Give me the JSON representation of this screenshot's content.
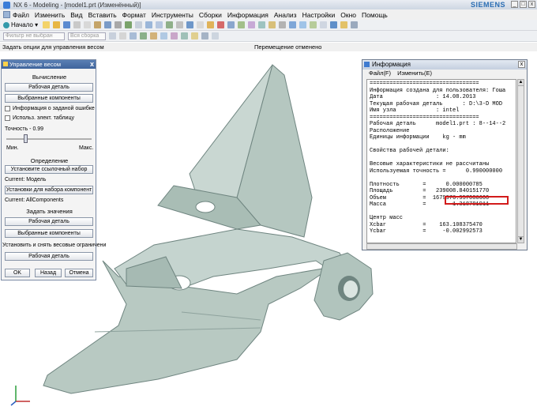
{
  "titlebar": {
    "title": "NX 6 - Modeling - [model1.prt (Изменённый)]",
    "brand": "SIEMENS",
    "min": "_",
    "max": "□",
    "close": "x"
  },
  "menu": {
    "items": [
      "Файл",
      "Изменить",
      "Вид",
      "Вставить",
      "Формат",
      "Инструменты",
      "Сборки",
      "Информация",
      "Анализ",
      "Настройки",
      "Окно",
      "Помощь"
    ]
  },
  "toolbar": {
    "start_label": "Начало ▾",
    "filter_placeholder": "Фильтр не выбран",
    "assembly_placeholder": "Вся сборка"
  },
  "status": {
    "left": "Задать опции для управления весом",
    "middle": "Перемещение отменено"
  },
  "weights_panel": {
    "title": "Управление весом",
    "close": "x",
    "calc_header": "Вычисление",
    "work_part_btn": "Рабочая деталь",
    "selected_components_btn": "Выбранные компоненты",
    "error_info_chk": "Информация о заданой ошибке",
    "use_table_chk": "Использ. элект. таблицу",
    "accuracy_label": "Точность - 0.99",
    "accuracy_value": 0.99,
    "min_label": "Мин.",
    "max_label": "Макс.",
    "definition_header": "Определение",
    "set_ref_btn": "Установите ссылочный набор",
    "current_model": "Current: Модель",
    "set_comp_btn": "Установки для набора компонент",
    "current_all": "Current: AllComponents",
    "set_values_header": "Задать значения",
    "work_part_btn2": "Рабочая деталь",
    "selected_components_btn2": "Выбранные компоненты",
    "limits_label": "Установить и снять весовые ограничени",
    "work_part_btn3": "Рабочая деталь",
    "ok": "OK",
    "back": "Назад",
    "cancel": "Отмена"
  },
  "info_window": {
    "title": "Информация",
    "menu_file": "Файл(F)",
    "menu_edit": "Изменить(E)",
    "lines": [
      "=================================",
      "Информация создана для пользователя: Гоша",
      "Дата                : 14.08.2013",
      "Текущая рабочая деталь      : D:\\3-D MOD",
      "Имя узла            : intel",
      "=================================",
      "Рабочая деталь      model1.prt : 8--14--2",
      "Расположение",
      "Единицы информации    kg - mm",
      "",
      "Свойства рабочей детали:",
      "",
      "Весовые характеристики не рассчитаны",
      "Используемая точность =      0.990000000",
      "",
      "Плотность       =      0.000000785",
      "Площадь         =   239008.840151770",
      "Объем           =  1679976.957086600",
      "Масса           =        1.318781911",
      "",
      "Центр масс",
      "Xcbar           =    163.108375470",
      "Ycbar           =     -0.002992573"
    ]
  },
  "colors": {
    "model_fill": "#b8c9c2",
    "highlight": "#d21b1b",
    "panel_title": "#4a70a8"
  }
}
